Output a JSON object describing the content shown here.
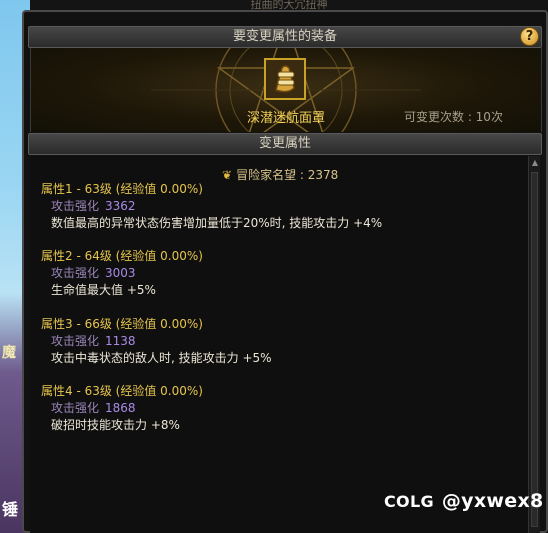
{
  "top_title": "扭曲的大冗扭神",
  "header": {
    "title": "要变更属性的装备",
    "help": "?"
  },
  "item": {
    "name": "深潜迷航面罩",
    "icon": "mask-item-icon"
  },
  "remaining": "可变更次数 : 10次",
  "section": {
    "title": "变更属性"
  },
  "fame": {
    "label": "冒险家名望 : 2378",
    "icon": "fame-icon"
  },
  "attributes": [
    {
      "title": "属性1 - 63级 (经验值 0.00%)",
      "stat_label": "攻击强化",
      "stat_value": "3362",
      "effect": "数值最高的异常状态伤害增加量低于20%时, 技能攻击力 +4%"
    },
    {
      "title": "属性2 - 64级 (经验值 0.00%)",
      "stat_label": "攻击强化",
      "stat_value": "3003",
      "effect": "生命值最大值 +5%"
    },
    {
      "title": "属性3 - 66级 (经验值 0.00%)",
      "stat_label": "攻击强化",
      "stat_value": "1138",
      "effect": "攻击中毒状态的敌人时, 技能攻击力 +5%"
    },
    {
      "title": "属性4 - 63级 (经验值 0.00%)",
      "stat_label": "攻击强化",
      "stat_value": "1868",
      "effect": "破招时技能攻击力 +8%"
    }
  ],
  "watermark": {
    "brand": "COLG",
    "handle": "@yxwex8"
  },
  "side_glyphs": [
    "魔",
    "锤"
  ],
  "colors": {
    "accent_gold": "#e6c54c",
    "item_name": "#f3d35b",
    "stat_value": "#a98be6"
  }
}
